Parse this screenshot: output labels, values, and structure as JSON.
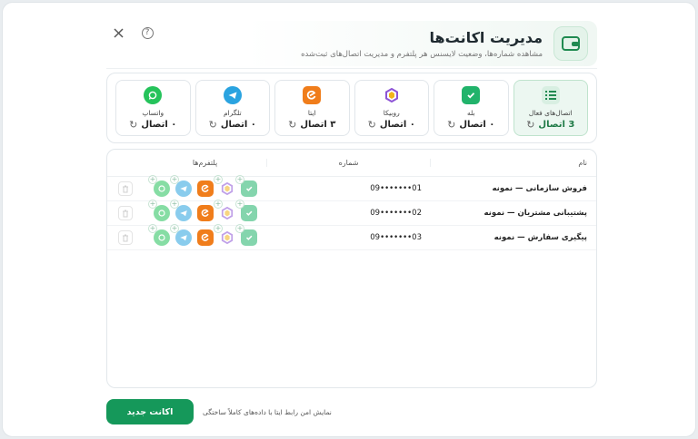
{
  "header": {
    "title": "مدیریت اکانت‌ها",
    "subtitle": "مشاهده شماره‌ها، وضعیت لایسنس هر پلتفرم و مدیریت اتصال‌های ثبت‌شده"
  },
  "cards": [
    {
      "label": "اتصال‌های فعال",
      "value": "3 اتصال",
      "icon": "list-icon",
      "active": true
    },
    {
      "label": "بله",
      "value": "۰ اتصال",
      "icon": "bale-icon"
    },
    {
      "label": "روبیکا",
      "value": "۰ اتصال",
      "icon": "rubika-icon"
    },
    {
      "label": "ایتا",
      "value": "۳ اتصال",
      "icon": "eitaa-icon"
    },
    {
      "label": "تلگرام",
      "value": "۰ اتصال",
      "icon": "telegram-icon"
    },
    {
      "label": "واتساپ",
      "value": "۰ اتصال",
      "icon": "whatsapp-icon"
    }
  ],
  "table": {
    "headers": {
      "name": "نام",
      "number": "شماره",
      "platforms": "پلتفرم‌ها"
    },
    "rows": [
      {
        "name": "فروش سازمانی — نمونه",
        "number": "09•••••••01"
      },
      {
        "name": "پشتیبانی مشتریان — نمونه",
        "number": "09•••••••02"
      },
      {
        "name": "پیگیری سفارش — نمونه",
        "number": "09•••••••03"
      }
    ]
  },
  "footer": {
    "new_account_label": "اکانت جدید",
    "note": "نمایش امن رابط ایتا با داده‌های کاملاً ساختگی"
  },
  "colors": {
    "accent": "#15985a",
    "bale": "#21b36b",
    "telegram": "#2aa3e0",
    "eitaa": "#f07d1b",
    "whatsapp": "#25c35b"
  }
}
